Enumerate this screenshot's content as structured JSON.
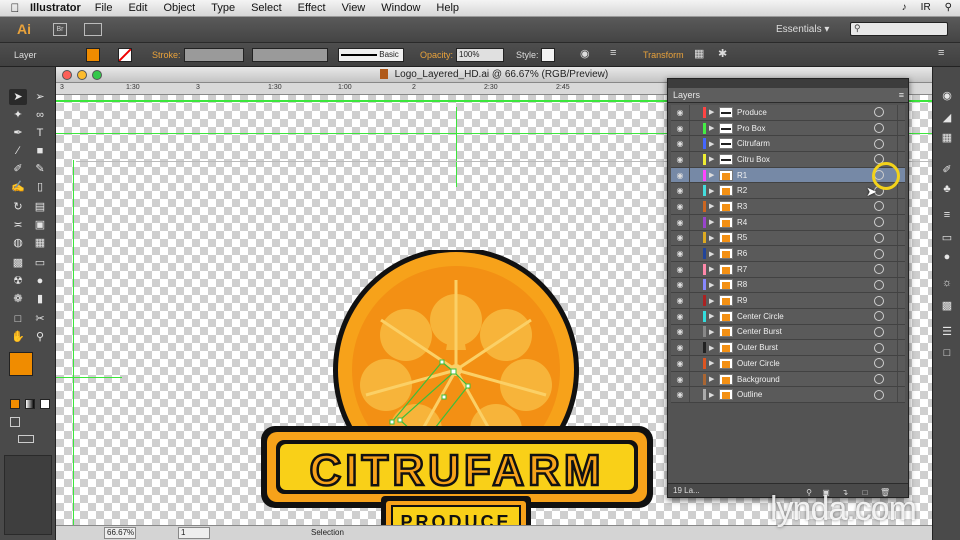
{
  "menubar": {
    "app_name": "Illustrator",
    "items": [
      "File",
      "Edit",
      "Object",
      "Type",
      "Select",
      "Effect",
      "View",
      "Window",
      "Help"
    ],
    "user": "IR"
  },
  "appbar": {
    "logo": "Ai",
    "bridge": "Br",
    "workspace": "Essentials",
    "search_placeholder": ""
  },
  "controlbar": {
    "selection_label": "Layer",
    "stroke_label": "Stroke:",
    "brush_label": "Basic",
    "opacity_label": "Opacity:",
    "opacity_value": "100%",
    "style_label": "Style:",
    "transform_label": "Transform",
    "fill_color": "#f08c00"
  },
  "document": {
    "title": "Logo_Layered_HD.ai @ 66.67% (RGB/Preview)",
    "zoom": "66.67%",
    "artboard": "1",
    "status": "Selection",
    "ruler_ticks": [
      "3",
      "1:30",
      "3",
      "1:30",
      "1:00",
      "2",
      "2:30",
      "2:45"
    ]
  },
  "logo": {
    "brand_text": "CITRUFARM",
    "sub_text": "PRODUCE"
  },
  "layers_panel": {
    "title": "Layers",
    "count_label": "19 La...",
    "active_index": 4,
    "layers": [
      {
        "name": "Produce",
        "color": "#ff4444"
      },
      {
        "name": "Pro Box",
        "color": "#44ee44"
      },
      {
        "name": "Citrufarm",
        "color": "#4466ff"
      },
      {
        "name": "Citru Box",
        "color": "#eeee33"
      },
      {
        "name": "R1",
        "color": "#ff44ff"
      },
      {
        "name": "R2",
        "color": "#44dddd"
      },
      {
        "name": "R3",
        "color": "#cc6622"
      },
      {
        "name": "R4",
        "color": "#9944cc"
      },
      {
        "name": "R5",
        "color": "#ddaa22"
      },
      {
        "name": "R6",
        "color": "#224499"
      },
      {
        "name": "R7",
        "color": "#ff88aa"
      },
      {
        "name": "R8",
        "color": "#8888ff"
      },
      {
        "name": "R9",
        "color": "#aa2222"
      },
      {
        "name": "Center Circle",
        "color": "#33dddd"
      },
      {
        "name": "Center Burst",
        "color": "#888888"
      },
      {
        "name": "Outer Burst",
        "color": "#222222"
      },
      {
        "name": "Outer Circle",
        "color": "#dd5522"
      },
      {
        "name": "Background",
        "color": "#aa6633"
      },
      {
        "name": "Outline",
        "color": "#aaaaaa"
      }
    ]
  },
  "watermark": "lynda.com"
}
